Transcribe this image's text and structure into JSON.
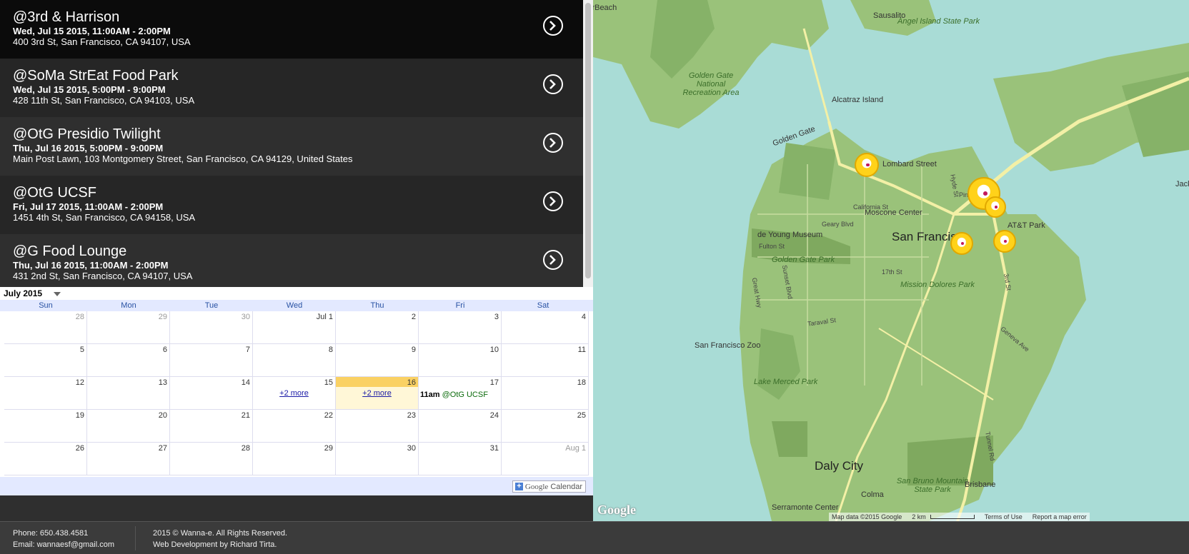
{
  "events": [
    {
      "title": "@3rd & Harrison",
      "when": "Wed, Jul 15 2015, 11:00AM - 2:00PM",
      "address": "400 3rd St, San Francisco, CA 94107, USA",
      "bg": "#0b0b0b"
    },
    {
      "title": "@SoMa StrEat Food Park",
      "when": "Wed, Jul 15 2015, 5:00PM - 9:00PM",
      "address": "428 11th St, San Francisco, CA 94103, USA",
      "bg": "#262626"
    },
    {
      "title": "@OtG Presidio Twilight",
      "when": "Thu, Jul 16 2015, 5:00PM - 9:00PM",
      "address": "Main Post Lawn, 103 Montgomery Street, San Francisco, CA 94129, United States",
      "bg": "#2f2f2f"
    },
    {
      "title": "@OtG UCSF",
      "when": "Fri, Jul 17 2015, 11:00AM - 2:00PM",
      "address": "1451 4th St, San Francisco, CA 94158, USA",
      "bg": "#262626"
    },
    {
      "title": "@G Food Lounge",
      "when": "Thu, Jul 16 2015, 11:00AM - 2:00PM",
      "address": "431 2nd St, San Francisco, CA 94107, USA",
      "bg": "#2f2f2f"
    }
  ],
  "calendar": {
    "month_label": "July 2015",
    "weekdays": [
      "Sun",
      "Mon",
      "Tue",
      "Wed",
      "Thu",
      "Fri",
      "Sat"
    ],
    "weeks": [
      [
        {
          "d": "28",
          "dim": true
        },
        {
          "d": "29",
          "dim": true
        },
        {
          "d": "30",
          "dim": true
        },
        {
          "d": "Jul 1"
        },
        {
          "d": "2"
        },
        {
          "d": "3"
        },
        {
          "d": "4"
        }
      ],
      [
        {
          "d": "5"
        },
        {
          "d": "6"
        },
        {
          "d": "7"
        },
        {
          "d": "8"
        },
        {
          "d": "9"
        },
        {
          "d": "10"
        },
        {
          "d": "11"
        }
      ],
      [
        {
          "d": "12"
        },
        {
          "d": "13"
        },
        {
          "d": "14"
        },
        {
          "d": "15",
          "more": "+2 more"
        },
        {
          "d": "16",
          "today": true,
          "more": "+2 more"
        },
        {
          "d": "17",
          "ev_time": "11am",
          "ev_title": "@OtG UCSF"
        },
        {
          "d": "18"
        }
      ],
      [
        {
          "d": "19"
        },
        {
          "d": "20"
        },
        {
          "d": "21"
        },
        {
          "d": "22"
        },
        {
          "d": "23"
        },
        {
          "d": "24"
        },
        {
          "d": "25"
        }
      ],
      [
        {
          "d": "26"
        },
        {
          "d": "27"
        },
        {
          "d": "28"
        },
        {
          "d": "29"
        },
        {
          "d": "30"
        },
        {
          "d": "31"
        },
        {
          "d": "Aug 1",
          "dim": true
        }
      ]
    ],
    "google_calendar_word1": "Google",
    "google_calendar_word2": "Calendar"
  },
  "map": {
    "labels": [
      {
        "t": "Sausalito",
        "cls": ""
      },
      {
        "t": "irBeach",
        "cls": ""
      },
      {
        "t": "Angel Island State Park",
        "cls": "park"
      },
      {
        "t": "Golden Gate National Recreation Area",
        "cls": "park"
      },
      {
        "t": "Alcatraz Island",
        "cls": ""
      },
      {
        "t": "Golden Gate",
        "cls": ""
      },
      {
        "t": "Lombard Street",
        "cls": ""
      },
      {
        "t": "Moscone Center",
        "cls": ""
      },
      {
        "t": "AT&T Park",
        "cls": ""
      },
      {
        "t": "San Francisco",
        "cls": "city"
      },
      {
        "t": "de Young Museum",
        "cls": ""
      },
      {
        "t": "Golden Gate Park",
        "cls": "park"
      },
      {
        "t": "Mission Dolores Park",
        "cls": "park"
      },
      {
        "t": "San Francisco Zoo",
        "cls": ""
      },
      {
        "t": "Lake Merced Park",
        "cls": "park"
      },
      {
        "t": "Daly City",
        "cls": "city"
      },
      {
        "t": "Colma",
        "cls": ""
      },
      {
        "t": "San Bruno Mountain State Park",
        "cls": "park"
      },
      {
        "t": "Brisbane",
        "cls": ""
      },
      {
        "t": "Serramonte Center",
        "cls": ""
      },
      {
        "t": "Jack Lo",
        "cls": ""
      }
    ],
    "roads": [
      "California St",
      "Geary Blvd",
      "Fulton St",
      "17th St",
      "Taraval St",
      "Great Hwy",
      "Sunset Blvd",
      "Pine",
      "Hyde St",
      "Geneva Ave",
      "3rd St",
      "Tunnel Rd"
    ],
    "footer_data": "Map data ©2015 Google",
    "footer_scale": "2 km",
    "footer_terms": "Terms of Use",
    "footer_report": "Report a map error",
    "logo": "Google",
    "marker_count": 5
  },
  "footer": {
    "phone": "Phone: 650.438.4581",
    "email": "Email: wannaesf@gmail.com",
    "copyright": "2015 © Wanna-e. All Rights Reserved.",
    "credit": "Web Development by Richard Tirta."
  },
  "colors": {
    "water": "#a9dcd6",
    "land": "#9ac27a",
    "highway": "#f3f0a6",
    "accent": "#fad163",
    "link": "#1a1aa6"
  }
}
